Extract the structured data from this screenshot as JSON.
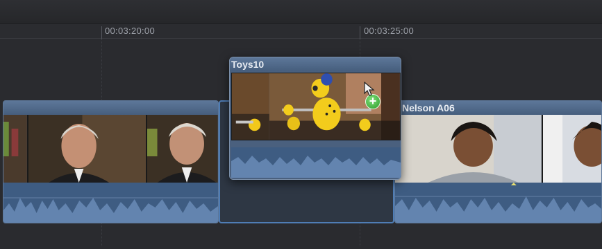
{
  "ruler": {
    "timecodes": [
      "00:03:20:00",
      "00:03:25:00"
    ]
  },
  "clips": {
    "left": {
      "title": ""
    },
    "dragged": {
      "title": "Toys10"
    },
    "right": {
      "title": "Nelson A06"
    }
  },
  "icons": {
    "add": "plus-icon",
    "pointer": "arrow-cursor-icon"
  },
  "colors": {
    "clip_header": "#5d7799",
    "audio_wave": "#3e5c82",
    "gap_outline": "#4f7db5",
    "add_badge": "#2c9a2a"
  }
}
